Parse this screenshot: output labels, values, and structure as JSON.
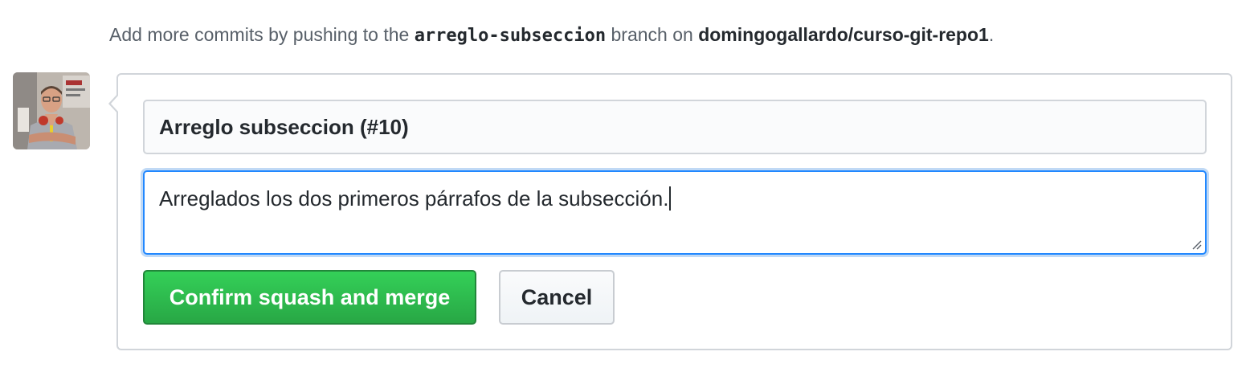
{
  "info": {
    "prefix": "Add more commits by pushing to the ",
    "branch": "arreglo-subseccion",
    "middle": " branch on ",
    "repo": "domingogallardo/curso-git-repo1",
    "suffix": "."
  },
  "avatar": {
    "icon": "user-avatar"
  },
  "merge_form": {
    "commit_title": "Arreglo subseccion (#10)",
    "commit_message": "Arreglados los dos primeros párrafos de la subsección.",
    "confirm_label": "Confirm squash and merge",
    "cancel_label": "Cancel"
  },
  "colors": {
    "primary_green": "#2cbe4e",
    "focus_blue": "#2188ff",
    "border_gray": "#d1d5da"
  }
}
